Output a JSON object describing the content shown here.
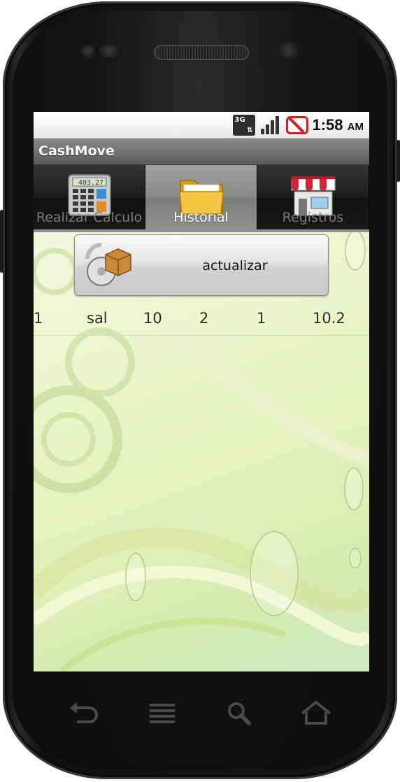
{
  "status_bar": {
    "network": "3G",
    "time": "1:58",
    "ampm": "AM"
  },
  "app": {
    "title": "CashMove"
  },
  "tabs": [
    {
      "label": "Realizar Calculo",
      "selected": false,
      "icon": "calculator-icon"
    },
    {
      "label": "Historial",
      "selected": true,
      "icon": "folder-icon"
    },
    {
      "label": "Registros",
      "selected": false,
      "icon": "store-icon"
    }
  ],
  "refresh_button": {
    "label": "actualizar",
    "icon": "refresh-box-icon"
  },
  "history": {
    "rows": [
      [
        "1",
        "sal",
        "10",
        "2",
        "1",
        "10.2"
      ]
    ]
  },
  "nav_keys": [
    "back-icon",
    "menu-icon",
    "search-icon",
    "home-icon"
  ],
  "colors": {
    "accent_selected_tab": "#909090",
    "background_green": "#e4f0bb",
    "no_sim_red": "#d81b1b"
  }
}
